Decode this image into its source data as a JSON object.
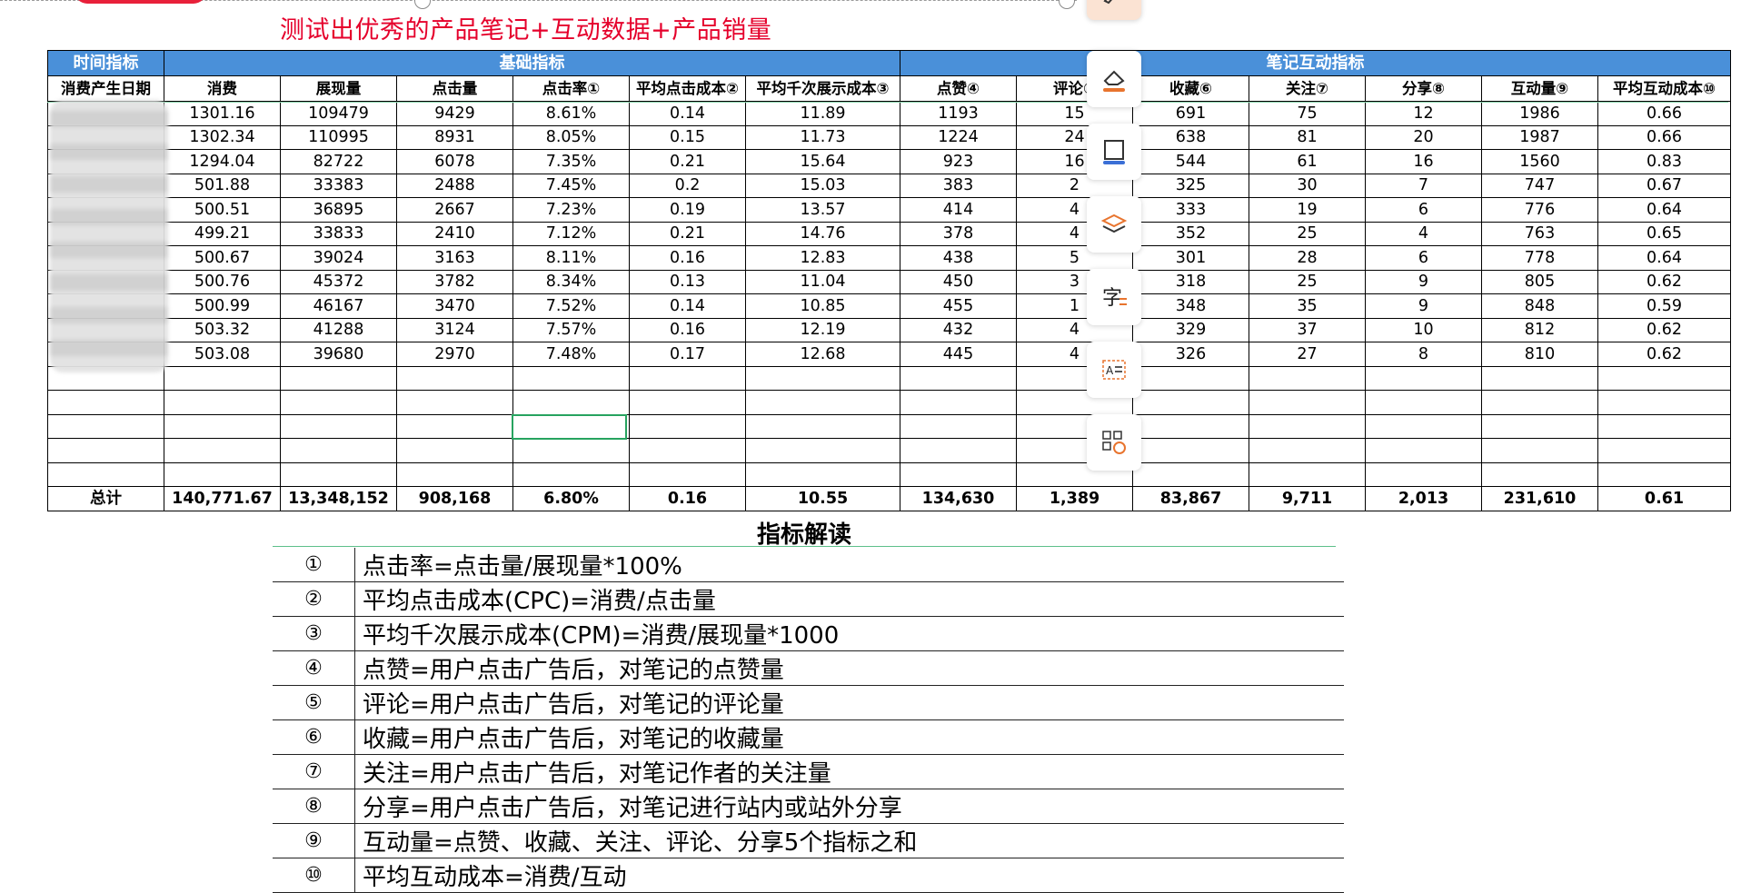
{
  "headline": "测试出优秀的产品笔记+互动数据+产品销量",
  "sheet": {
    "group_headers": [
      "时间指标",
      "基础指标",
      "笔记互动指标"
    ],
    "columns": [
      "消费产生日期",
      "消费",
      "展现量",
      "点击量",
      "点击率①",
      "平均点击成本②",
      "平均千次展示成本③",
      "点赞④",
      "评论⑤",
      "收藏⑥",
      "关注⑦",
      "分享⑧",
      "互动量⑨",
      "平均互动成本⑩"
    ],
    "rows": [
      [
        "",
        "1301.16",
        "109479",
        "9429",
        "8.61%",
        "0.14",
        "11.89",
        "1193",
        "15",
        "691",
        "75",
        "12",
        "1986",
        "0.66"
      ],
      [
        "",
        "1302.34",
        "110995",
        "8931",
        "8.05%",
        "0.15",
        "11.73",
        "1224",
        "24",
        "638",
        "81",
        "20",
        "1987",
        "0.66"
      ],
      [
        "",
        "1294.04",
        "82722",
        "6078",
        "7.35%",
        "0.21",
        "15.64",
        "923",
        "16",
        "544",
        "61",
        "16",
        "1560",
        "0.83"
      ],
      [
        "",
        "501.88",
        "33383",
        "2488",
        "7.45%",
        "0.2",
        "15.03",
        "383",
        "2",
        "325",
        "30",
        "7",
        "747",
        "0.67"
      ],
      [
        "",
        "500.51",
        "36895",
        "2667",
        "7.23%",
        "0.19",
        "13.57",
        "414",
        "4",
        "333",
        "19",
        "6",
        "776",
        "0.64"
      ],
      [
        "",
        "499.21",
        "33833",
        "2410",
        "7.12%",
        "0.21",
        "14.76",
        "378",
        "4",
        "352",
        "25",
        "4",
        "763",
        "0.65"
      ],
      [
        "",
        "500.67",
        "39024",
        "3163",
        "8.11%",
        "0.16",
        "12.83",
        "438",
        "5",
        "301",
        "28",
        "6",
        "778",
        "0.64"
      ],
      [
        "",
        "500.76",
        "45372",
        "3782",
        "8.34%",
        "0.13",
        "11.04",
        "450",
        "3",
        "318",
        "25",
        "9",
        "805",
        "0.62"
      ],
      [
        "",
        "500.99",
        "46167",
        "3470",
        "7.52%",
        "0.14",
        "10.85",
        "455",
        "1",
        "348",
        "35",
        "9",
        "848",
        "0.59"
      ],
      [
        "",
        "503.32",
        "41288",
        "3124",
        "7.57%",
        "0.16",
        "12.19",
        "432",
        "4",
        "329",
        "37",
        "10",
        "812",
        "0.62"
      ],
      [
        "",
        "503.08",
        "39680",
        "2970",
        "7.48%",
        "0.17",
        "12.68",
        "445",
        "4",
        "326",
        "27",
        "8",
        "810",
        "0.62"
      ]
    ],
    "empty_rows": 5,
    "total": [
      "总计",
      "140,771.67",
      "13,348,152",
      "908,168",
      "6.80%",
      "0.16",
      "10.55",
      "134,630",
      "1,389",
      "83,867",
      "9,711",
      "2,013",
      "231,610",
      "0.61"
    ]
  },
  "toolbar": [
    "eraser-icon",
    "frame-icon",
    "layers-icon",
    "translate-text-icon",
    "ocr-text-icon",
    "apps-icon"
  ],
  "notes": {
    "title": "指标解读",
    "items": [
      {
        "num": "①",
        "text": "点击率=点击量/展现量*100%"
      },
      {
        "num": "②",
        "text": "平均点击成本(CPC)=消费/点击量"
      },
      {
        "num": "③",
        "text": "平均千次展示成本(CPM)=消费/展现量*1000"
      },
      {
        "num": "④",
        "text": "点赞=用户点击广告后，对笔记的点赞量"
      },
      {
        "num": "⑤",
        "text": "评论=用户点击广告后，对笔记的评论量"
      },
      {
        "num": "⑥",
        "text": "收藏=用户点击广告后，对笔记的收藏量"
      },
      {
        "num": "⑦",
        "text": "关注=用户点击广告后，对笔记作者的关注量"
      },
      {
        "num": "⑧",
        "text": "分享=用户点击广告后，对笔记进行站内或站外分享"
      },
      {
        "num": "⑨",
        "text": "互动量=点赞、收藏、关注、评论、分享5个指标之和"
      },
      {
        "num": "⑩",
        "text": "平均互动成本=消费/互动"
      }
    ]
  }
}
